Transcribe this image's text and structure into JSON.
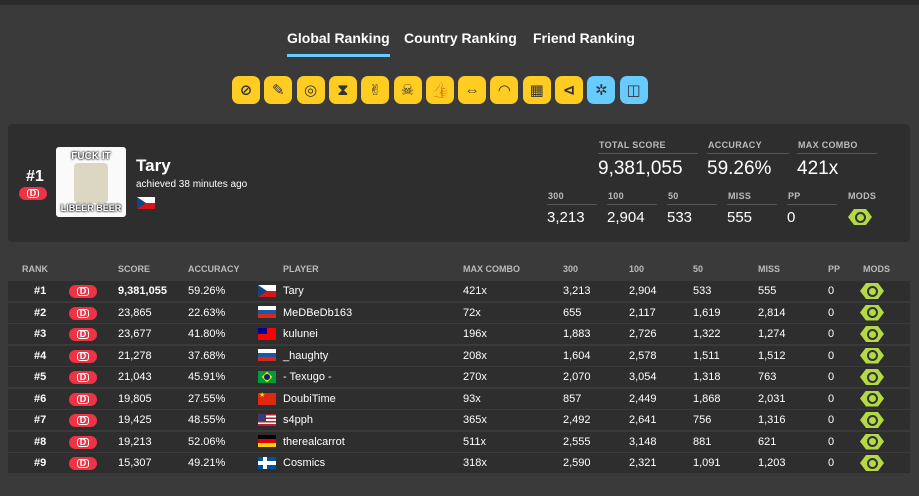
{
  "tabs": [
    {
      "label": "Global Ranking",
      "active": true
    },
    {
      "label": "Country Ranking",
      "active": false
    },
    {
      "label": "Friend Ranking",
      "active": false
    }
  ],
  "mods": [
    {
      "name": "no-fail-icon",
      "glyph": "⊘",
      "color": "#ffcc22"
    },
    {
      "name": "easy-icon",
      "glyph": "✎",
      "color": "#ffcc22"
    },
    {
      "name": "no-video-icon",
      "glyph": "◎",
      "color": "#ffcc22"
    },
    {
      "name": "half-time-icon",
      "glyph": "⧗",
      "color": "#ffcc22"
    },
    {
      "name": "hard-rock-icon",
      "glyph": "✌",
      "color": "#ffcc22"
    },
    {
      "name": "sudden-death-icon",
      "glyph": "☠",
      "color": "#ffcc22"
    },
    {
      "name": "perfect-icon",
      "glyph": "👍",
      "color": "#ffcc22"
    },
    {
      "name": "double-time-icon",
      "glyph": "⇔",
      "color": "#ffcc22"
    },
    {
      "name": "nightcore-icon",
      "glyph": "◠",
      "color": "#ffcc22"
    },
    {
      "name": "hidden-icon",
      "glyph": "▦",
      "color": "#ffcc22"
    },
    {
      "name": "flashlight-icon",
      "glyph": "⊲",
      "color": "#ffcc22"
    },
    {
      "name": "spun-out-icon",
      "glyph": "✲",
      "color": "#66ccff"
    },
    {
      "name": "score-v2-icon",
      "glyph": "◫",
      "color": "#66ccff"
    }
  ],
  "top": {
    "rank": "#1",
    "grade": "D",
    "avatar_top": "FUCK IT",
    "avatar_bottom": "LIBEER BEER",
    "player": "Tary",
    "achieved": "achieved 38 minutes ago",
    "flag": "cz",
    "total_score_label": "TOTAL SCORE",
    "total_score": "9,381,055",
    "accuracy_label": "ACCURACY",
    "accuracy": "59.26%",
    "max_combo_label": "MAX COMBO",
    "max_combo": "421x",
    "c300_label": "300",
    "c300": "3,213",
    "c100_label": "100",
    "c100": "2,904",
    "c50_label": "50",
    "c50": "533",
    "miss_label": "MISS",
    "miss": "555",
    "pp_label": "PP",
    "pp": "0",
    "mods_label": "MODS"
  },
  "table": {
    "headers": {
      "rank": "RANK",
      "score": "SCORE",
      "accuracy": "ACCURACY",
      "player": "PLAYER",
      "max_combo": "MAX COMBO",
      "c300": "300",
      "c100": "100",
      "c50": "50",
      "miss": "MISS",
      "pp": "PP",
      "mods": "MODS"
    },
    "rows": [
      {
        "rank": "#1",
        "grade": "D",
        "score": "9,381,055",
        "accuracy": "59.26%",
        "flag": "cz",
        "player": "Tary",
        "max_combo": "421x",
        "c300": "3,213",
        "c100": "2,904",
        "c50": "533",
        "miss": "555",
        "pp": "0"
      },
      {
        "rank": "#2",
        "grade": "D",
        "score": "23,865",
        "accuracy": "22.63%",
        "flag": "ru",
        "player": "MeDBeDb163",
        "max_combo": "72x",
        "c300": "655",
        "c100": "2,117",
        "c50": "1,619",
        "miss": "2,814",
        "pp": "0"
      },
      {
        "rank": "#3",
        "grade": "D",
        "score": "23,677",
        "accuracy": "41.80%",
        "flag": "tw",
        "player": "kulunei",
        "max_combo": "196x",
        "c300": "1,883",
        "c100": "2,726",
        "c50": "1,322",
        "miss": "1,274",
        "pp": "0"
      },
      {
        "rank": "#4",
        "grade": "D",
        "score": "21,278",
        "accuracy": "37.68%",
        "flag": "ru",
        "player": "_haughty",
        "max_combo": "208x",
        "c300": "1,604",
        "c100": "2,578",
        "c50": "1,511",
        "miss": "1,512",
        "pp": "0"
      },
      {
        "rank": "#5",
        "grade": "D",
        "score": "21,043",
        "accuracy": "45.91%",
        "flag": "br",
        "player": "- Texugo -",
        "max_combo": "270x",
        "c300": "2,070",
        "c100": "3,054",
        "c50": "1,318",
        "miss": "763",
        "pp": "0"
      },
      {
        "rank": "#6",
        "grade": "D",
        "score": "19,805",
        "accuracy": "27.55%",
        "flag": "cn",
        "player": "DoubiTime",
        "max_combo": "93x",
        "c300": "857",
        "c100": "2,449",
        "c50": "1,868",
        "miss": "2,031",
        "pp": "0"
      },
      {
        "rank": "#7",
        "grade": "D",
        "score": "19,425",
        "accuracy": "48.55%",
        "flag": "us",
        "player": "s4pph",
        "max_combo": "365x",
        "c300": "2,492",
        "c100": "2,641",
        "c50": "756",
        "miss": "1,316",
        "pp": "0"
      },
      {
        "rank": "#8",
        "grade": "D",
        "score": "19,213",
        "accuracy": "52.06%",
        "flag": "de",
        "player": "therealcarrot",
        "max_combo": "511x",
        "c300": "2,555",
        "c100": "3,148",
        "c50": "881",
        "miss": "621",
        "pp": "0"
      },
      {
        "rank": "#9",
        "grade": "D",
        "score": "15,307",
        "accuracy": "49.21%",
        "flag": "is",
        "player": "Cosmics",
        "max_combo": "318x",
        "c300": "2,590",
        "c100": "2,321",
        "c50": "1,091",
        "miss": "1,203",
        "pp": "0"
      }
    ]
  }
}
